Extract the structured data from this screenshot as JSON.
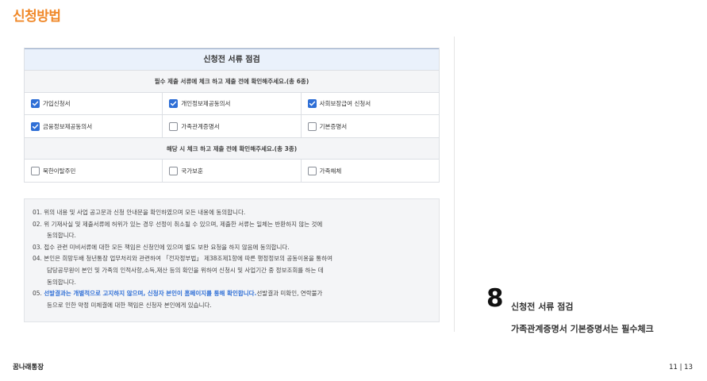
{
  "page_title": "신청방법",
  "form": {
    "title": "신청전 서류 점검",
    "required_header": "필수 제출 서류에 체크 하고 제출 전에 확인해주세요.(총 6종)",
    "required_rows": [
      [
        {
          "label": "가입신청서",
          "checked": true
        },
        {
          "label": "개인정보제공동의서",
          "checked": true
        },
        {
          "label": "사회보장급여 신청서",
          "checked": true
        }
      ],
      [
        {
          "label": "금융정보제공동의서",
          "checked": true
        },
        {
          "label": "가족관계증명서",
          "checked": false
        },
        {
          "label": "기본증명서",
          "checked": false
        }
      ]
    ],
    "optional_header": "해당 시 체크 하고 제출 전에 확인해주세요.(총 3종)",
    "optional_rows": [
      [
        {
          "label": "북한이탈주민",
          "checked": false
        },
        {
          "label": "국가보훈",
          "checked": false
        },
        {
          "label": "가족해체",
          "checked": false
        }
      ]
    ]
  },
  "notice": {
    "line1": "01. 위의 내용 및 사업 공고문과 신청 안내문을 확인하였으며 모든 내용에 동의합니다.",
    "line2a": "02. 위 기재사실 및 제출서류에 허위가 있는 경우 선정이 취소될 수 있으며, 제출한 서류는 일체는 반환하지 않는 것에",
    "line2b": "동의합니다.",
    "line3": "03. 접수 관련 미비서류에 대한 모든 책임은 신청인에 있으며 별도 보완 요청을 하지 않음에 동의합니다.",
    "line4a": "04. 본인은 희망두배 청년통장 업무처리와 관련하여 「전자정부법」 제38조제1항에 따른 행정정보의 공동이용을 통하여",
    "line4b": "담당공무원이 본인 및 가족의 인적사항,소득,재산 등의 확인을 위하여 신청시 및 사업기간 중 정보조회를 하는 데",
    "line4c": "동의합니다.",
    "line5_prefix": "05. ",
    "line5_highlight": "선발결과는 개별적으로 고지하지 않으며, 신청자 본인이 홈페이지를 통해 확인합니다.",
    "line5_suffix": "선발결과 미확인, 연락불가",
    "line5b": "등으로 인한 약정 미체결에 대한 책임은 신청자 본인에게 있습니다."
  },
  "step": {
    "number": "8",
    "title": "신청전 서류 점검",
    "note": "가족관계증명서 기본증명서는 필수체크"
  },
  "footer": {
    "brand": "꿈나래통장",
    "page": "11 | 13"
  },
  "colors": {
    "accent": "#f0892a",
    "checkbox_blue": "#2f6fd6"
  }
}
